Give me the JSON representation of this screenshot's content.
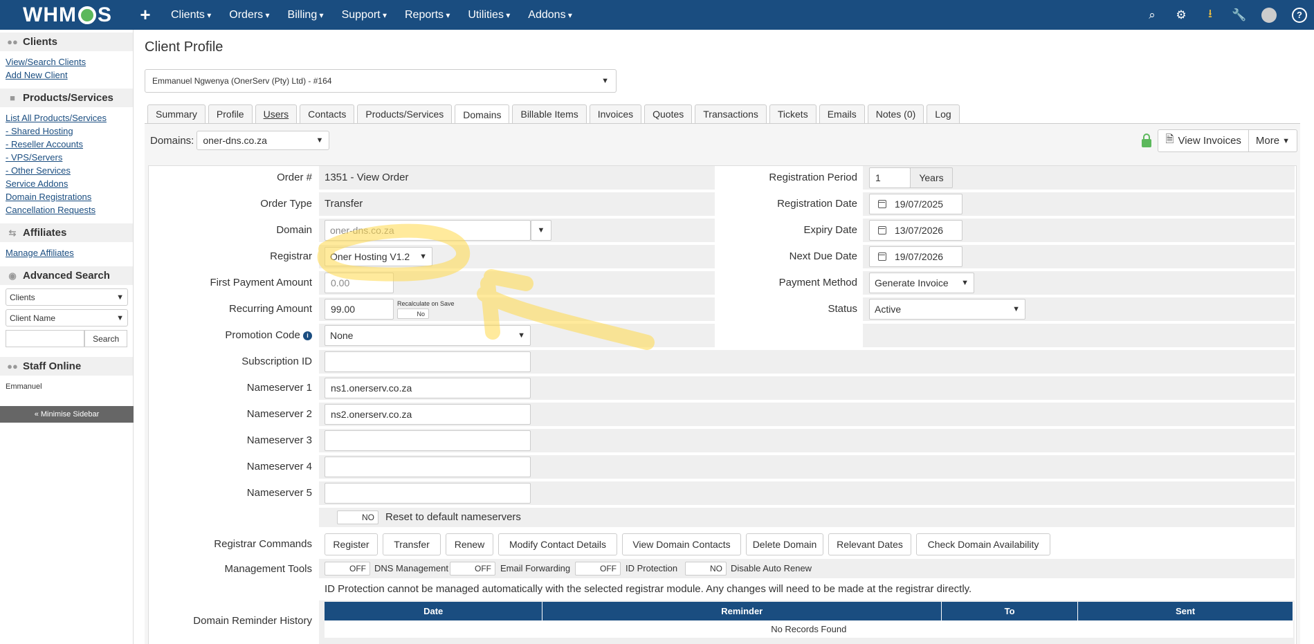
{
  "topbar": {
    "logo": "WHMCS",
    "plus": "+",
    "menu": [
      "Clients",
      "Orders",
      "Billing",
      "Support",
      "Reports",
      "Utilities",
      "Addons"
    ],
    "icons": [
      "search-icon",
      "cogs-icon",
      "download-icon",
      "wrench-icon",
      "avatar-icon",
      "help-icon"
    ]
  },
  "sidebar": {
    "clients_title": "Clients",
    "clients_links": [
      "View/Search Clients",
      "Add New Client"
    ],
    "products_title": "Products/Services",
    "products_links": [
      "List All Products/Services",
      "- Shared Hosting",
      "- Reseller Accounts",
      "- VPS/Servers",
      "- Other Services",
      "Service Addons",
      "Domain Registrations",
      "Cancellation Requests"
    ],
    "affiliates_title": "Affiliates",
    "affiliates_links": [
      "Manage Affiliates"
    ],
    "advsearch_title": "Advanced Search",
    "search_type": "Clients",
    "search_field": "Client Name",
    "search_button": "Search",
    "staff_title": "Staff Online",
    "staff_name": "Emmanuel",
    "minimise": "« Minimise Sidebar"
  },
  "main": {
    "page_title": "Client Profile",
    "client_select": "Emmanuel Ngwenya (OnerServ (Pty) Ltd) - #164",
    "tabs": [
      "Summary",
      "Profile",
      "Users",
      "Contacts",
      "Products/Services",
      "Domains",
      "Billable Items",
      "Invoices",
      "Quotes",
      "Transactions",
      "Tickets",
      "Emails",
      "Notes (0)",
      "Log"
    ],
    "domains_label": "Domains:",
    "domains_value": "oner-dns.co.za",
    "view_invoices": "View Invoices",
    "more": "More"
  },
  "form": {
    "order_label": "Order #",
    "order_value": "1351 - View Order",
    "order_type_label": "Order Type",
    "order_type_value": "Transfer",
    "domain_label": "Domain",
    "domain_value": "oner-dns.co.za",
    "registrar_label": "Registrar",
    "registrar_value": "Oner Hosting V1.2",
    "first_payment_label": "First Payment Amount",
    "first_payment_value": "0.00",
    "recurring_label": "Recurring Amount",
    "recurring_value": "99.00",
    "recalc_label": "Recalculate on Save",
    "recalc_value": "No",
    "promo_label": "Promotion Code",
    "promo_value": "None",
    "subscription_label": "Subscription ID",
    "subscription_value": "",
    "ns1_label": "Nameserver 1",
    "ns1_value": "ns1.onerserv.co.za",
    "ns2_label": "Nameserver 2",
    "ns2_value": "ns2.onerserv.co.za",
    "ns3_label": "Nameserver 3",
    "ns4_label": "Nameserver 4",
    "ns5_label": "Nameserver 5",
    "reset_toggle": "NO",
    "reset_label": "Reset to default nameservers",
    "reg_period_label": "Registration Period",
    "reg_period_value": "1",
    "reg_period_unit": "Years",
    "reg_date_label": "Registration Date",
    "reg_date_value": "19/07/2025",
    "expiry_label": "Expiry Date",
    "expiry_value": "13/07/2026",
    "next_due_label": "Next Due Date",
    "next_due_value": "19/07/2026",
    "payment_method_label": "Payment Method",
    "payment_method_value": "Generate Invoice",
    "status_label": "Status",
    "status_value": "Active",
    "registrar_commands_label": "Registrar Commands",
    "commands": [
      "Register",
      "Transfer",
      "Renew",
      "Modify Contact Details",
      "View Domain Contacts",
      "Delete Domain",
      "Relevant Dates",
      "Check Domain Availability"
    ],
    "mgmt_label": "Management Tools",
    "tools": [
      {
        "toggle": "OFF",
        "label": "DNS Management"
      },
      {
        "toggle": "OFF",
        "label": "Email Forwarding"
      },
      {
        "toggle": "OFF",
        "label": "ID Protection"
      },
      {
        "toggle": "NO",
        "label": "Disable Auto Renew"
      }
    ],
    "id_protection_note": "ID Protection cannot be managed automatically with the selected registrar module. Any changes will need to be made at the registrar directly.",
    "reminder_label": "Domain Reminder History",
    "reminder_headers": [
      "Date",
      "Reminder",
      "To",
      "Sent"
    ],
    "reminder_empty": "No Records Found"
  },
  "colors": {
    "brand": "#1a4d80",
    "highlight": "#ffe680",
    "secure": "#5cb85c"
  }
}
